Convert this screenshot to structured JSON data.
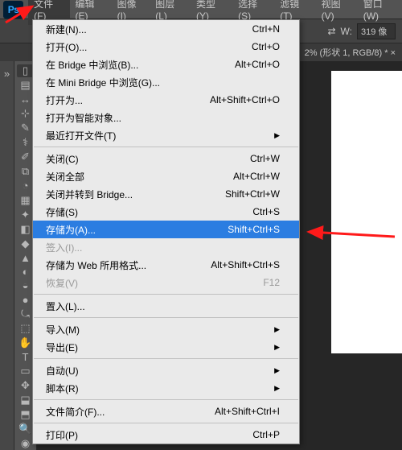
{
  "app": {
    "logo": "Ps"
  },
  "menubar": [
    "文件(F)",
    "编辑(E)",
    "图像(I)",
    "图层(L)",
    "类型(Y)",
    "选择(S)",
    "滤镜(T)",
    "视图(V)",
    "窗口(W)"
  ],
  "toolbar": {
    "w_label": "W:",
    "w_value": "319 像",
    "arrows_icon": "⇄"
  },
  "tab": {
    "title": "2% (形状 1, RGB/8) * ×"
  },
  "dropdown": [
    {
      "type": "item",
      "label": "新建(N)...",
      "shortcut": "Ctrl+N"
    },
    {
      "type": "item",
      "label": "打开(O)...",
      "shortcut": "Ctrl+O"
    },
    {
      "type": "item",
      "label": "在 Bridge 中浏览(B)...",
      "shortcut": "Alt+Ctrl+O"
    },
    {
      "type": "item",
      "label": "在 Mini Bridge 中浏览(G)...",
      "shortcut": ""
    },
    {
      "type": "item",
      "label": "打开为...",
      "shortcut": "Alt+Shift+Ctrl+O"
    },
    {
      "type": "item",
      "label": "打开为智能对象...",
      "shortcut": ""
    },
    {
      "type": "sub",
      "label": "最近打开文件(T)",
      "shortcut": ""
    },
    {
      "type": "sep"
    },
    {
      "type": "item",
      "label": "关闭(C)",
      "shortcut": "Ctrl+W"
    },
    {
      "type": "item",
      "label": "关闭全部",
      "shortcut": "Alt+Ctrl+W"
    },
    {
      "type": "item",
      "label": "关闭并转到 Bridge...",
      "shortcut": "Shift+Ctrl+W"
    },
    {
      "type": "item",
      "label": "存储(S)",
      "shortcut": "Ctrl+S"
    },
    {
      "type": "item",
      "label": "存储为(A)...",
      "shortcut": "Shift+Ctrl+S",
      "highlight": true
    },
    {
      "type": "item",
      "label": "签入(I)...",
      "shortcut": "",
      "disabled": true
    },
    {
      "type": "item",
      "label": "存储为 Web 所用格式...",
      "shortcut": "Alt+Shift+Ctrl+S"
    },
    {
      "type": "item",
      "label": "恢复(V)",
      "shortcut": "F12",
      "disabled": true
    },
    {
      "type": "sep"
    },
    {
      "type": "item",
      "label": "置入(L)...",
      "shortcut": ""
    },
    {
      "type": "sep"
    },
    {
      "type": "sub",
      "label": "导入(M)",
      "shortcut": ""
    },
    {
      "type": "sub",
      "label": "导出(E)",
      "shortcut": ""
    },
    {
      "type": "sep"
    },
    {
      "type": "sub",
      "label": "自动(U)",
      "shortcut": ""
    },
    {
      "type": "sub",
      "label": "脚本(R)",
      "shortcut": ""
    },
    {
      "type": "sep"
    },
    {
      "type": "item",
      "label": "文件简介(F)...",
      "shortcut": "Alt+Shift+Ctrl+I"
    },
    {
      "type": "sep"
    },
    {
      "type": "item",
      "label": "打印(P)",
      "shortcut": "Ctrl+P"
    }
  ],
  "tools": [
    "▯",
    "▤",
    "↔",
    "⊹",
    "✎",
    "⚕",
    "✐",
    "⧉",
    "◔",
    "▦",
    "✦",
    "◧",
    "◆",
    "▲",
    "◐",
    "◒",
    "●",
    "⤿",
    "⬚",
    "✋",
    "T",
    "▭",
    "✥",
    "⬓",
    "⬒",
    "🔍",
    "◉"
  ]
}
